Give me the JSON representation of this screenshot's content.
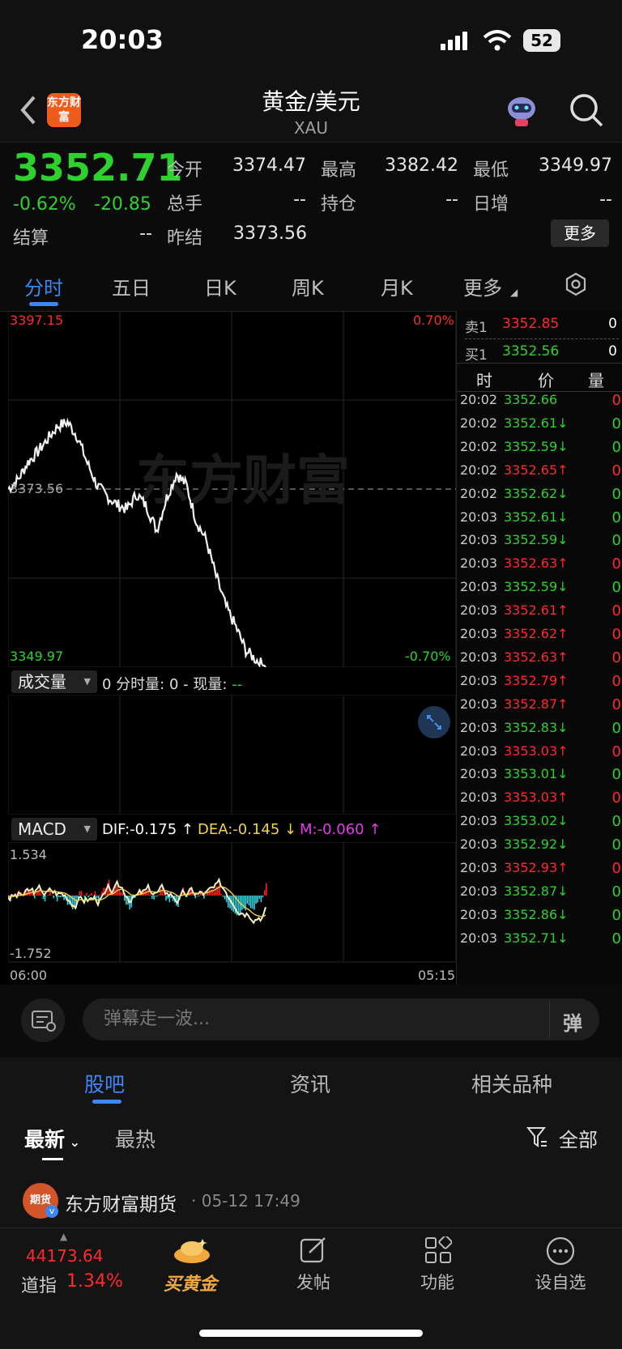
{
  "status": {
    "time": "20:03",
    "battery": "52"
  },
  "header": {
    "title": "黄金/美元",
    "subtitle": "XAU",
    "logo_text": "东方财富"
  },
  "quote": {
    "price": "3352.71",
    "change_pct": "-0.62%",
    "change": "-20.85",
    "open_label": "今开",
    "open": "3374.47",
    "high_label": "最高",
    "high": "3382.42",
    "low_label": "最低",
    "low": "3349.97",
    "volume_label": "总手",
    "volume": "--",
    "oi_label": "持仓",
    "oi": "--",
    "dayinc_label": "日增",
    "dayinc": "--",
    "settle_label": "结算",
    "settle": "--",
    "prev_label": "昨结",
    "prev": "3373.56",
    "more": "更多"
  },
  "tabs": [
    "分时",
    "五日",
    "日K",
    "周K",
    "月K",
    "更多"
  ],
  "chart": {
    "top_price": "3397.15",
    "top_pct": "0.70%",
    "mid_price": "3373.56",
    "bottom_price": "3349.97",
    "bottom_pct": "-0.70%",
    "watermark": "东方财富",
    "volume_selector": "成交量",
    "volume_info": "0 分时量: 0 - 现量: ",
    "volume_now": "--",
    "macd_selector": "MACD",
    "dif": "DIF:-0.175 ↑",
    "dea": "DEA:-0.145 ↓",
    "m": "M:-0.060 ↑",
    "macd_top": "1.534",
    "macd_bottom": "-1.752",
    "time_start": "06:00",
    "time_end": "05:15"
  },
  "chart_data": {
    "type": "line",
    "series": [
      {
        "values": [
          3373.56,
          3374.8,
          3377.1,
          3378.5,
          3380.2,
          3381.9,
          3382.42,
          3380.5,
          3377.0,
          3374.0,
          3372.6,
          3371.5,
          3370.9,
          3372.9,
          3371.2,
          3368.1,
          3372.4,
          3375.6,
          3374.1,
          3369.3,
          3366.8,
          3362.0,
          3358.0,
          3355.3,
          3352.2,
          3351.0,
          3349.97
        ]
      }
    ],
    "ylim": [
      3349.97,
      3397.15
    ]
  },
  "orderbook": {
    "sell_label": "卖1",
    "sell_price": "3352.85",
    "sell_vol": "0",
    "buy_label": "买1",
    "buy_price": "3352.56",
    "buy_vol": "0",
    "col_time": "时",
    "col_price": "价",
    "col_vol": "量"
  },
  "ticks": [
    {
      "t": "20:02",
      "p": "3352.66",
      "d": "",
      "v": "0"
    },
    {
      "t": "20:02",
      "p": "3352.61",
      "d": "↓",
      "v": "0"
    },
    {
      "t": "20:02",
      "p": "3352.59",
      "d": "↓",
      "v": "0"
    },
    {
      "t": "20:02",
      "p": "3352.65",
      "d": "↑",
      "v": "0"
    },
    {
      "t": "20:02",
      "p": "3352.62",
      "d": "↓",
      "v": "0"
    },
    {
      "t": "20:03",
      "p": "3352.61",
      "d": "↓",
      "v": "0"
    },
    {
      "t": "20:03",
      "p": "3352.59",
      "d": "↓",
      "v": "0"
    },
    {
      "t": "20:03",
      "p": "3352.63",
      "d": "↑",
      "v": "0"
    },
    {
      "t": "20:03",
      "p": "3352.59",
      "d": "↓",
      "v": "0"
    },
    {
      "t": "20:03",
      "p": "3352.61",
      "d": "↑",
      "v": "0"
    },
    {
      "t": "20:03",
      "p": "3352.62",
      "d": "↑",
      "v": "0"
    },
    {
      "t": "20:03",
      "p": "3352.63",
      "d": "↑",
      "v": "0"
    },
    {
      "t": "20:03",
      "p": "3352.79",
      "d": "↑",
      "v": "0"
    },
    {
      "t": "20:03",
      "p": "3352.87",
      "d": "↑",
      "v": "0"
    },
    {
      "t": "20:03",
      "p": "3352.83",
      "d": "↓",
      "v": "0"
    },
    {
      "t": "20:03",
      "p": "3353.03",
      "d": "↑",
      "v": "0"
    },
    {
      "t": "20:03",
      "p": "3353.01",
      "d": "↓",
      "v": "0"
    },
    {
      "t": "20:03",
      "p": "3353.03",
      "d": "↑",
      "v": "0"
    },
    {
      "t": "20:03",
      "p": "3353.02",
      "d": "↓",
      "v": "0"
    },
    {
      "t": "20:03",
      "p": "3352.92",
      "d": "↓",
      "v": "0"
    },
    {
      "t": "20:03",
      "p": "3352.93",
      "d": "↑",
      "v": "0"
    },
    {
      "t": "20:03",
      "p": "3352.87",
      "d": "↓",
      "v": "0"
    },
    {
      "t": "20:03",
      "p": "3352.86",
      "d": "↓",
      "v": "0"
    },
    {
      "t": "20:03",
      "p": "3352.71",
      "d": "↓",
      "v": "0"
    }
  ],
  "danmu": {
    "placeholder": "弹幕走一波...",
    "btn": "弹"
  },
  "community": {
    "tabs": [
      "股吧",
      "资讯",
      "相关品种"
    ],
    "sort_new": "最新",
    "sort_hot": "最热",
    "filter": "全部",
    "post_author": "东方财富期货",
    "post_time": "· 05-12 17:49",
    "avatar_text": "期货"
  },
  "bottom": {
    "index_value": "44173.64",
    "index_name": "道指",
    "index_pct": "1.34%",
    "buy_gold": "买黄金",
    "post": "发帖",
    "functions": "功能",
    "watchlist": "设自选"
  }
}
